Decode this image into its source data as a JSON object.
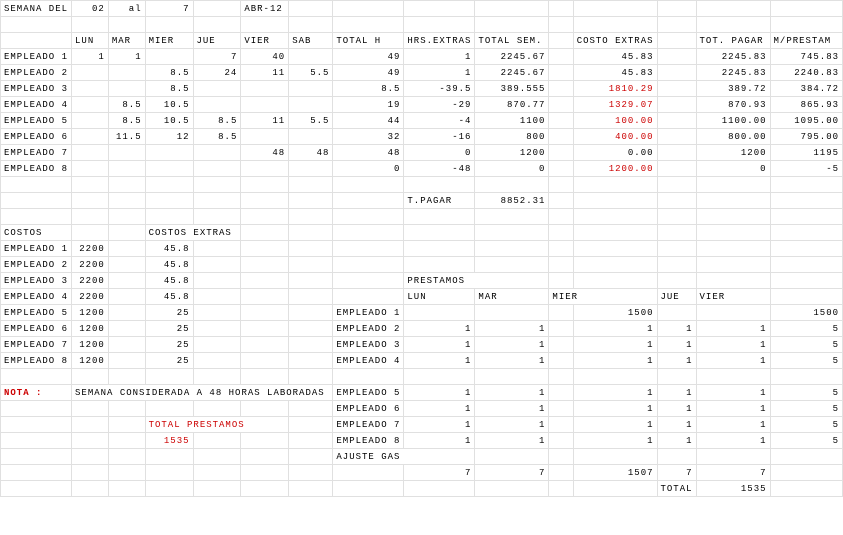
{
  "header": {
    "semana_del_label": "semana del",
    "semana_del_value": "02",
    "al_label": "al",
    "al_value": "7",
    "month": "abr-12"
  },
  "days": {
    "lun": "lun",
    "mar": "mar",
    "mier": "mier",
    "jue": "jue",
    "vier": "vier",
    "sab": "sab"
  },
  "cols": {
    "total_h": "total h",
    "hrs_extras": "hrs.extras",
    "total_sem": "total sem.",
    "costo_extras": "costo extras",
    "tot_pagar": "tot. pagar",
    "m_prestam": "m/prestam"
  },
  "main": {
    "rows": [
      {
        "name": "empleado 1",
        "lun": "1",
        "mar": "1",
        "mier": "",
        "jue": "7",
        "vier": "40",
        "sab": "",
        "tot_h": "49",
        "hrs_e": "1",
        "tot_sem": "2245.67",
        "costo_e": "45.83",
        "red": false,
        "tot_pagar": "2245.83",
        "m_prest": "745.83"
      },
      {
        "name": "empleado 2",
        "lun": "",
        "mar": "",
        "mier": "8.5",
        "jue": "24",
        "vier": "11",
        "sab": "5.5",
        "tot_h": "49",
        "hrs_e": "1",
        "tot_sem": "2245.67",
        "costo_e": "45.83",
        "red": false,
        "tot_pagar": "2245.83",
        "m_prest": "2240.83"
      },
      {
        "name": "empleado 3",
        "lun": "",
        "mar": "",
        "mier": "8.5",
        "jue": "",
        "vier": "",
        "sab": "",
        "tot_h": "8.5",
        "hrs_e": "-39.5",
        "tot_sem": "389.555",
        "costo_e": "1810.29",
        "red": true,
        "tot_pagar": "389.72",
        "m_prest": "384.72"
      },
      {
        "name": "empleado 4",
        "lun": "",
        "mar": "8.5",
        "mier": "10.5",
        "jue": "",
        "vier": "",
        "sab": "",
        "tot_h": "19",
        "hrs_e": "-29",
        "tot_sem": "870.77",
        "costo_e": "1329.07",
        "red": true,
        "tot_pagar": "870.93",
        "m_prest": "865.93"
      },
      {
        "name": "empleado 5",
        "lun": "",
        "mar": "8.5",
        "mier": "10.5",
        "jue": "8.5",
        "vier": "11",
        "sab": "5.5",
        "tot_h": "44",
        "hrs_e": "-4",
        "tot_sem": "1100",
        "costo_e": "100.00",
        "red": true,
        "tot_pagar": "1100.00",
        "m_prest": "1095.00"
      },
      {
        "name": "empleado 6",
        "lun": "",
        "mar": "11.5",
        "mier": "12",
        "jue": "8.5",
        "vier": "",
        "sab": "",
        "tot_h": "32",
        "hrs_e": "-16",
        "tot_sem": "800",
        "costo_e": "400.00",
        "red": true,
        "tot_pagar": "800.00",
        "m_prest": "795.00"
      },
      {
        "name": "empleado 7",
        "lun": "",
        "mar": "",
        "mier": "",
        "jue": "",
        "vier": "48",
        "sab": "48",
        "tot_h": "48",
        "hrs_e": "0",
        "tot_sem": "1200",
        "costo_e": "0.00",
        "red": false,
        "tot_pagar": "1200",
        "m_prest": "1195"
      },
      {
        "name": "empleado 8",
        "lun": "",
        "mar": "",
        "mier": "",
        "jue": "",
        "vier": "",
        "sab": "",
        "tot_h": "0",
        "hrs_e": "-48",
        "tot_sem": "0",
        "costo_e": "1200.00",
        "red": true,
        "tot_pagar": "0",
        "m_prest": "-5"
      }
    ],
    "t_pagar_label": "t.pagar",
    "t_pagar_value": "8852.31"
  },
  "costos": {
    "costos_label": "costos",
    "costos_extras_label": "costos extras",
    "rows": [
      {
        "name": "empleado 1",
        "c": "2200",
        "ce": "45.8"
      },
      {
        "name": "empleado 2",
        "c": "2200",
        "ce": "45.8"
      },
      {
        "name": "empleado 3",
        "c": "2200",
        "ce": "45.8"
      },
      {
        "name": "empleado 4",
        "c": "2200",
        "ce": "45.8"
      },
      {
        "name": "empleado 5",
        "c": "1200",
        "ce": "25"
      },
      {
        "name": "empleado 6",
        "c": "1200",
        "ce": "25"
      },
      {
        "name": "empleado 7",
        "c": "1200",
        "ce": "25"
      },
      {
        "name": "empleado 8",
        "c": "1200",
        "ce": "25"
      }
    ]
  },
  "prestamos": {
    "label": "prestamos",
    "days": {
      "lun": "lun",
      "mar": "mar",
      "mier": "mier",
      "jue": "jue",
      "vier": "vier"
    },
    "rows": [
      {
        "name": "empleado 1",
        "lun": "",
        "mar": "",
        "mier": "1500",
        "jue": "",
        "vier": "",
        "tot": "1500"
      },
      {
        "name": "empleado 2",
        "lun": "1",
        "mar": "1",
        "mier": "1",
        "jue": "1",
        "vier": "1",
        "tot": "5"
      },
      {
        "name": "empleado 3",
        "lun": "1",
        "mar": "1",
        "mier": "1",
        "jue": "1",
        "vier": "1",
        "tot": "5"
      },
      {
        "name": "empleado 4",
        "lun": "1",
        "mar": "1",
        "mier": "1",
        "jue": "1",
        "vier": "1",
        "tot": "5"
      },
      {
        "name": "empleado 5",
        "lun": "1",
        "mar": "1",
        "mier": "1",
        "jue": "1",
        "vier": "1",
        "tot": "5"
      },
      {
        "name": "empleado 6",
        "lun": "1",
        "mar": "1",
        "mier": "1",
        "jue": "1",
        "vier": "1",
        "tot": "5"
      },
      {
        "name": "empleado 7",
        "lun": "1",
        "mar": "1",
        "mier": "1",
        "jue": "1",
        "vier": "1",
        "tot": "5"
      },
      {
        "name": "empleado 8",
        "lun": "1",
        "mar": "1",
        "mier": "1",
        "jue": "1",
        "vier": "1",
        "tot": "5"
      }
    ],
    "ajuste_label": "ajuste gas",
    "sum": {
      "lun": "7",
      "mar": "7",
      "mier": "1507",
      "jue": "7",
      "vier": "7"
    },
    "total_label": "total",
    "total_value": "1535"
  },
  "nota": {
    "label": "NOTA :",
    "text": "semana considerada a 48 horas laboradas",
    "total_prestamos_label": "total prestamos",
    "total_prestamos_value": "1535"
  }
}
